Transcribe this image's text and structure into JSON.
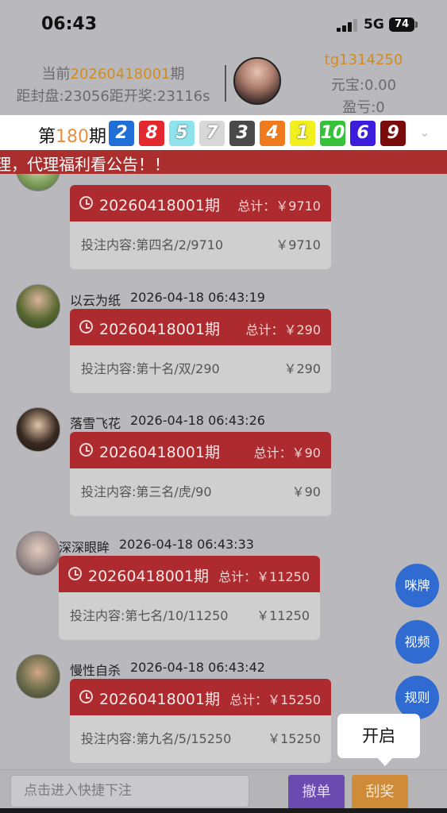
{
  "status_bar": {
    "time": "06:43",
    "network": "5G",
    "battery": "74"
  },
  "header": {
    "period_prefix": "当前",
    "period_number": "20260418001",
    "period_suffix": "期",
    "countdown": "距封盘:23056距开奖:23116s",
    "username": "tg1314250",
    "yuanbao": "元宝:0.00",
    "profit": "盈亏:0"
  },
  "result": {
    "prefix": "第",
    "issue": "180",
    "suffix": "期",
    "balls": [
      {
        "value": "2",
        "color": "#1f6fd6"
      },
      {
        "value": "8",
        "color": "#e3282e"
      },
      {
        "value": "5",
        "color": "#8fe3ec"
      },
      {
        "value": "7",
        "color": "#d8d8d8"
      },
      {
        "value": "3",
        "color": "#4a4a4a"
      },
      {
        "value": "4",
        "color": "#f07a1e"
      },
      {
        "value": "1",
        "color": "#f2ef1f"
      },
      {
        "value": "10",
        "color": "#36c13a"
      },
      {
        "value": "6",
        "color": "#3b1ddb"
      },
      {
        "value": "9",
        "color": "#7a0b0b"
      }
    ]
  },
  "marquee": "理，代理福利看公告！！",
  "messages": [
    {
      "name": "",
      "time": "",
      "issue": "20260418001期",
      "total": "总计：￥9710",
      "content": "投注内容:第四名/2/9710",
      "amount": "￥9710"
    },
    {
      "name": "以云为纸",
      "time": "2026-04-18 06:43:19",
      "issue": "20260418001期",
      "total": "总计：￥290",
      "content": "投注内容:第十名/双/290",
      "amount": "￥290"
    },
    {
      "name": "落雪飞花",
      "time": "2026-04-18 06:43:26",
      "issue": "20260418001期",
      "total": "总计：￥90",
      "content": "投注内容:第三名/虎/90",
      "amount": "￥90"
    },
    {
      "name": "深深眼眸",
      "time": "2026-04-18 06:43:33",
      "issue": "20260418001期",
      "total": "总计：￥11250",
      "content": "投注内容:第七名/10/11250",
      "amount": "￥11250"
    },
    {
      "name": "慢性自杀",
      "time": "2026-04-18 06:43:42",
      "issue": "20260418001期",
      "total": "总计：￥15250",
      "content": "投注内容:第九名/5/15250",
      "amount": "￥15250"
    }
  ],
  "fabs": {
    "mipai": "咪牌",
    "video": "视频",
    "rules": "规则"
  },
  "tooltip": "开启",
  "bottom": {
    "placeholder": "点击进入快捷下注",
    "cancel": "撤单",
    "scratch": "刮奖"
  }
}
